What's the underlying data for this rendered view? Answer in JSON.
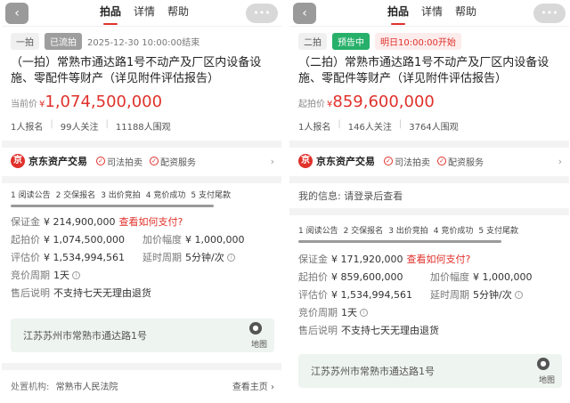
{
  "header": {
    "back_icon": "‹",
    "tabs": [
      "拍品",
      "详情",
      "帮助"
    ],
    "right_label": "•••"
  },
  "left": {
    "round": "一拍",
    "state": "已流拍",
    "end_time": "2025-12-30 10:00:00结束",
    "title": "（一拍）常熟市通达路1号不动产及厂区内设备设施、零配件等财产（详见附件评估报告）",
    "price_label": "当前价",
    "price_symbol": "¥",
    "price_value": "1,074,500,000",
    "stats": [
      "1人报名",
      "99人关注",
      "11188人围观"
    ],
    "platform": "京东资产交易",
    "badges": [
      "司法拍卖",
      "配资服务"
    ],
    "steps": [
      "1 阅读公告",
      "2 交保报名",
      "3 出价竞拍",
      "4 竞价成功",
      "5 支付尾款"
    ],
    "deposit_label": "保证金",
    "deposit_value": "¥ 214,900,000",
    "pay_link": "查看如何支付?",
    "start_label": "起拍价",
    "start_value": "¥ 1,074,500,000",
    "incr_label": "加价幅度",
    "incr_value": "¥ 1,000,000",
    "appraise_label": "评估价",
    "appraise_value": "¥ 1,534,994,561",
    "delay_label": "延时周期",
    "delay_value": "5分钟/次",
    "cycle_label": "竞价周期",
    "cycle_value": "1天",
    "after_label": "售后说明",
    "after_value": "不支持七天无理由退货",
    "address": "江苏苏州市常熟市通达路1号",
    "map_label": "地图",
    "org_label": "处置机构:",
    "org_value": "常熟市人民法院",
    "home_link": "查看主页 ›"
  },
  "right": {
    "round": "二拍",
    "state": "预告中",
    "start_time": "明日10:00:00开始",
    "title": "（二拍）常熟市通达路1号不动产及厂区内设备设施、零配件等财产（详见附件评估报告）",
    "price_label": "起拍价",
    "price_symbol": "¥",
    "price_value": "859,600,000",
    "stats": [
      "1人报名",
      "146人关注",
      "3764人围观"
    ],
    "platform": "京东资产交易",
    "badges": [
      "司法拍卖",
      "配资服务"
    ],
    "my_info": "我的信息:  请登录后查看",
    "steps": [
      "1 阅读公告",
      "2 交保报名",
      "3 出价竞拍",
      "4 竞价成功",
      "5 支付尾款"
    ],
    "deposit_label": "保证金",
    "deposit_value": "¥ 171,920,000",
    "pay_link": "查看如何支付?",
    "start_label": "起拍价",
    "start_value": "¥ 859,600,000",
    "incr_label": "加价幅度",
    "incr_value": "¥ 1,000,000",
    "appraise_label": "评估价",
    "appraise_value": "¥ 1,534,994,561",
    "delay_label": "延时周期",
    "delay_value": "5分钟/次",
    "cycle_label": "竞价周期",
    "cycle_value": "1天",
    "after_label": "售后说明",
    "after_value": "不支持七天无理由退货",
    "address": "江苏苏州市常熟市通达路1号",
    "map_label": "地图"
  },
  "colors": {
    "accent": "#e0312b",
    "preview_green": "#27b06a",
    "grey_tag": "#9e9e9e"
  }
}
